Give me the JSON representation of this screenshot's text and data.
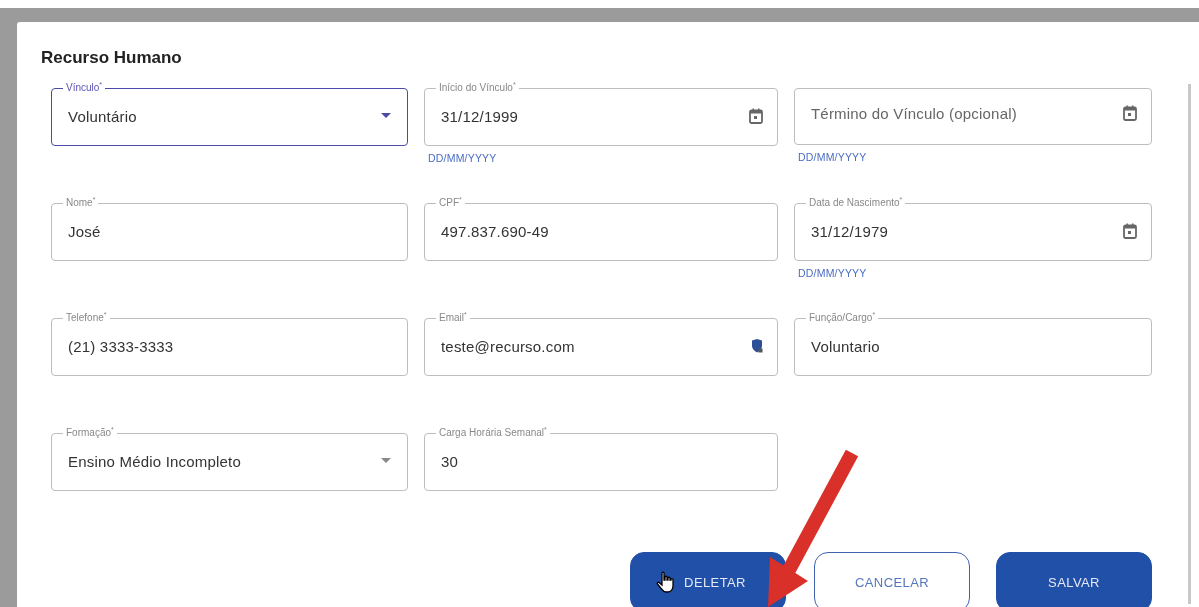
{
  "dialog": {
    "title": "Recurso Humano",
    "fields": [
      {
        "label": "Vínculo$^{*}$",
        "kind": "select",
        "value": "Voluntário",
        "focused": true
      },
      {
        "label": "Início do Vínculo$^{*}$",
        "kind": "date",
        "value": "31/12/1999",
        "helper": "DD/MM/YYYY",
        "focused": false
      },
      {
        "kind": "date",
        "placeholder": "Término do Vínculo (opcional)",
        "helper": "DD/MM/YYYY",
        "focused": false
      },
      {
        "label": "Nome$^{*}$",
        "kind": "text",
        "value": "José",
        "focused": false
      },
      {
        "label": "CPF$^{*}$",
        "kind": "text",
        "value": "497.837.690-49",
        "focused": false
      },
      {
        "label": "Data de Nascimento$^{*}$",
        "kind": "date",
        "value": "31/12/1979",
        "helper": "DD/MM/YYYY",
        "focused": false
      },
      {
        "label": "Telefone$^{*}$",
        "kind": "text",
        "value": "(21) 3333-3333",
        "focused": false
      },
      {
        "label": "Email$^{*}$",
        "kind": "email",
        "value": "teste@recurso.com",
        "focused": false
      },
      {
        "label": "Função/Cargo$^{*}$",
        "kind": "text",
        "value": "Voluntario",
        "focused": false
      },
      {
        "label": "Formação$^{*}$",
        "kind": "select",
        "value": "Ensino Médio Incompleto",
        "focused": false
      },
      {
        "label": "Carga Horária Semanal$^{*}$",
        "kind": "text",
        "value": "30",
        "focused": false
      }
    ],
    "buttons": [
      {
        "label": "DELETAR",
        "kind": "filled",
        "hovered": true
      },
      {
        "label": "CANCELAR",
        "kind": "outlined",
        "hovered": false
      },
      {
        "label": "SALVAR",
        "kind": "filled",
        "hovered": false
      }
    ]
  }
}
